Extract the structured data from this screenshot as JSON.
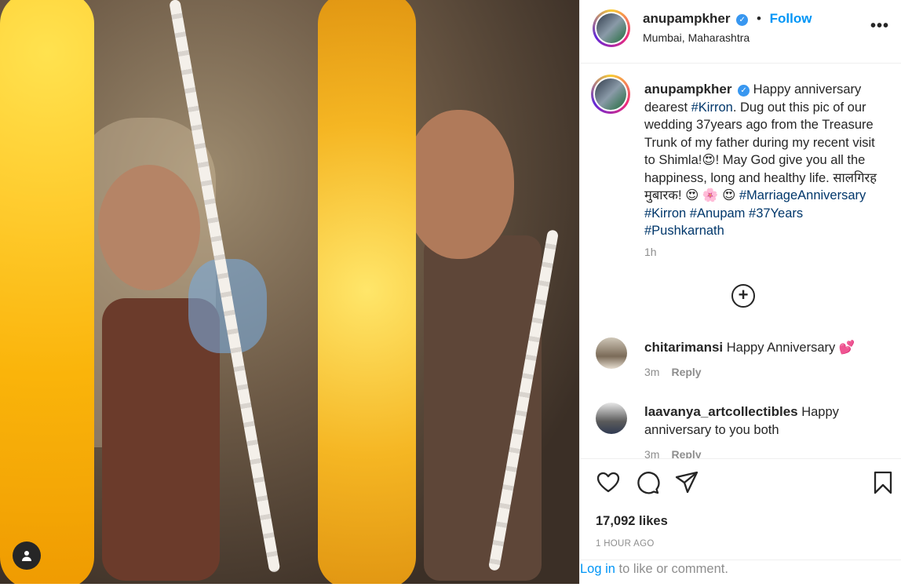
{
  "post": {
    "username": "anupampkher",
    "follow_label": "Follow",
    "location": "Mumbai, Maharashtra",
    "more_label": "•••"
  },
  "caption": {
    "username": "anupampkher",
    "text_1": "Happy anniversary dearest ",
    "tag_kirron": "#Kirron",
    "text_2": ". Dug out this pic of our wedding 37years ago from the Treasure Trunk of my father during my recent visit to Shimla!😍! May God give you all the happiness, long and healthy life. सालगिरह मुबारक! 😍 🌸 😍",
    "tags": [
      "#MarriageAnniversary",
      "#Kirron",
      "#Anupam",
      "#37Years",
      "#Pushkarnath"
    ],
    "time": "1h"
  },
  "comments": [
    {
      "username": "chitarimansi",
      "text": "Happy Anniversary 💕",
      "time": "3m",
      "reply_label": "Reply"
    },
    {
      "username": "laavanya_artcollectibles",
      "text": "Happy anniversary to you both",
      "time": "3m",
      "reply_label": "Reply"
    }
  ],
  "footer": {
    "likes": "17,092 likes",
    "ago": "1 HOUR AGO",
    "login_label": "Log in",
    "login_suffix": " to like or comment."
  },
  "icons": {
    "verified": "verified-badge-icon",
    "like": "heart-icon",
    "comment": "comment-bubble-icon",
    "share": "paper-plane-icon",
    "save": "bookmark-icon",
    "load_more": "plus-circle-icon",
    "user": "user-icon"
  },
  "colors": {
    "accent_blue": "#0095f6",
    "hashtag": "#00376b",
    "muted": "#8e8e8e"
  }
}
